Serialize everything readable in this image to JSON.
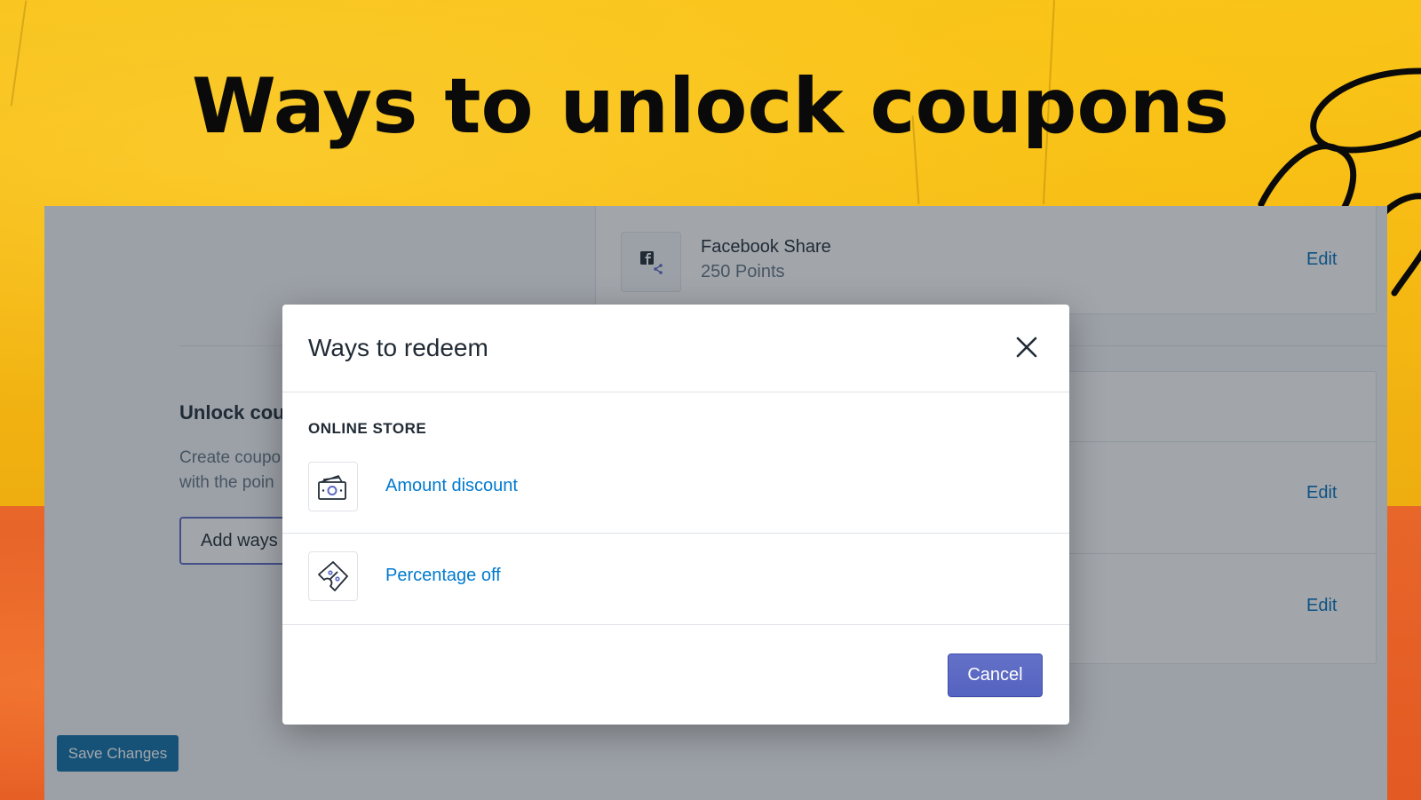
{
  "headline": "Ways to unlock coupons",
  "background": {
    "panel": {
      "unlock_title": "Unlock cou",
      "unlock_desc_line1": "Create coupo",
      "unlock_desc_line2": "with the poin",
      "add_ways_button": "Add ways",
      "save_button": "Save Changes"
    },
    "earn_items": [
      {
        "name": "Facebook Share",
        "points": "250 Points",
        "action": "Edit"
      }
    ],
    "edit_links": [
      "Edit",
      "Edit"
    ]
  },
  "modal": {
    "title": "Ways to redeem",
    "section_label": "ONLINE STORE",
    "options": [
      {
        "label": "Amount discount",
        "icon": "cash-icon"
      },
      {
        "label": "Percentage off",
        "icon": "percent-tag-icon"
      }
    ],
    "cancel_label": "Cancel"
  },
  "colors": {
    "primary": "#5c6ac4",
    "link": "#007ace",
    "save": "#0e6fa8",
    "background_yellow": "#f3b512",
    "background_orange": "#e35a22"
  }
}
